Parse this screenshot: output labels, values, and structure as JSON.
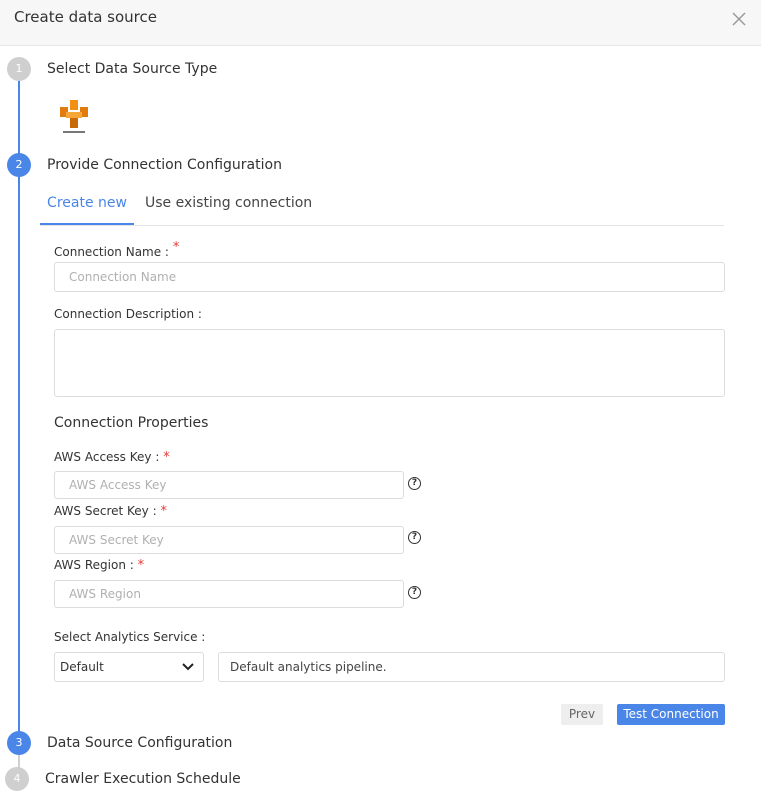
{
  "dialog": {
    "title": "Create data source"
  },
  "steps": [
    {
      "number": "1",
      "label": "Select Data Source Type"
    },
    {
      "number": "2",
      "label": "Provide Connection Configuration"
    },
    {
      "number": "3",
      "label": "Data Source Configuration"
    },
    {
      "number": "4",
      "label": "Crawler Execution Schedule"
    }
  ],
  "tabs": [
    {
      "label": "Create new"
    },
    {
      "label": "Use existing connection"
    }
  ],
  "form": {
    "connection_name": {
      "label": "Connection Name :",
      "placeholder": "Connection Name",
      "value": ""
    },
    "connection_description": {
      "label": "Connection Description :",
      "value": ""
    },
    "properties_title": "Connection Properties",
    "aws_access_key": {
      "label": "AWS Access Key :",
      "placeholder": "AWS Access Key",
      "value": ""
    },
    "aws_secret_key": {
      "label": "AWS Secret Key :",
      "placeholder": "AWS Secret Key",
      "value": ""
    },
    "aws_region": {
      "label": "AWS Region :",
      "placeholder": "AWS Region",
      "value": ""
    },
    "analytics_service": {
      "label": "Select Analytics Service :",
      "selected": "Default",
      "description": "Default analytics pipeline."
    },
    "required_marker": "*",
    "help_glyph": "?"
  },
  "buttons": {
    "prev": "Prev",
    "test_connection": "Test Connection"
  },
  "icons": {
    "close": "close-icon",
    "logo": "aws-logo-icon",
    "help": "question-circle-icon",
    "dropdown": "chevron-down-icon"
  },
  "colors": {
    "accent": "#4a86e8",
    "required": "#e53935",
    "step_inactive": "#cfcfcf",
    "logo_orange": "#f29111"
  }
}
